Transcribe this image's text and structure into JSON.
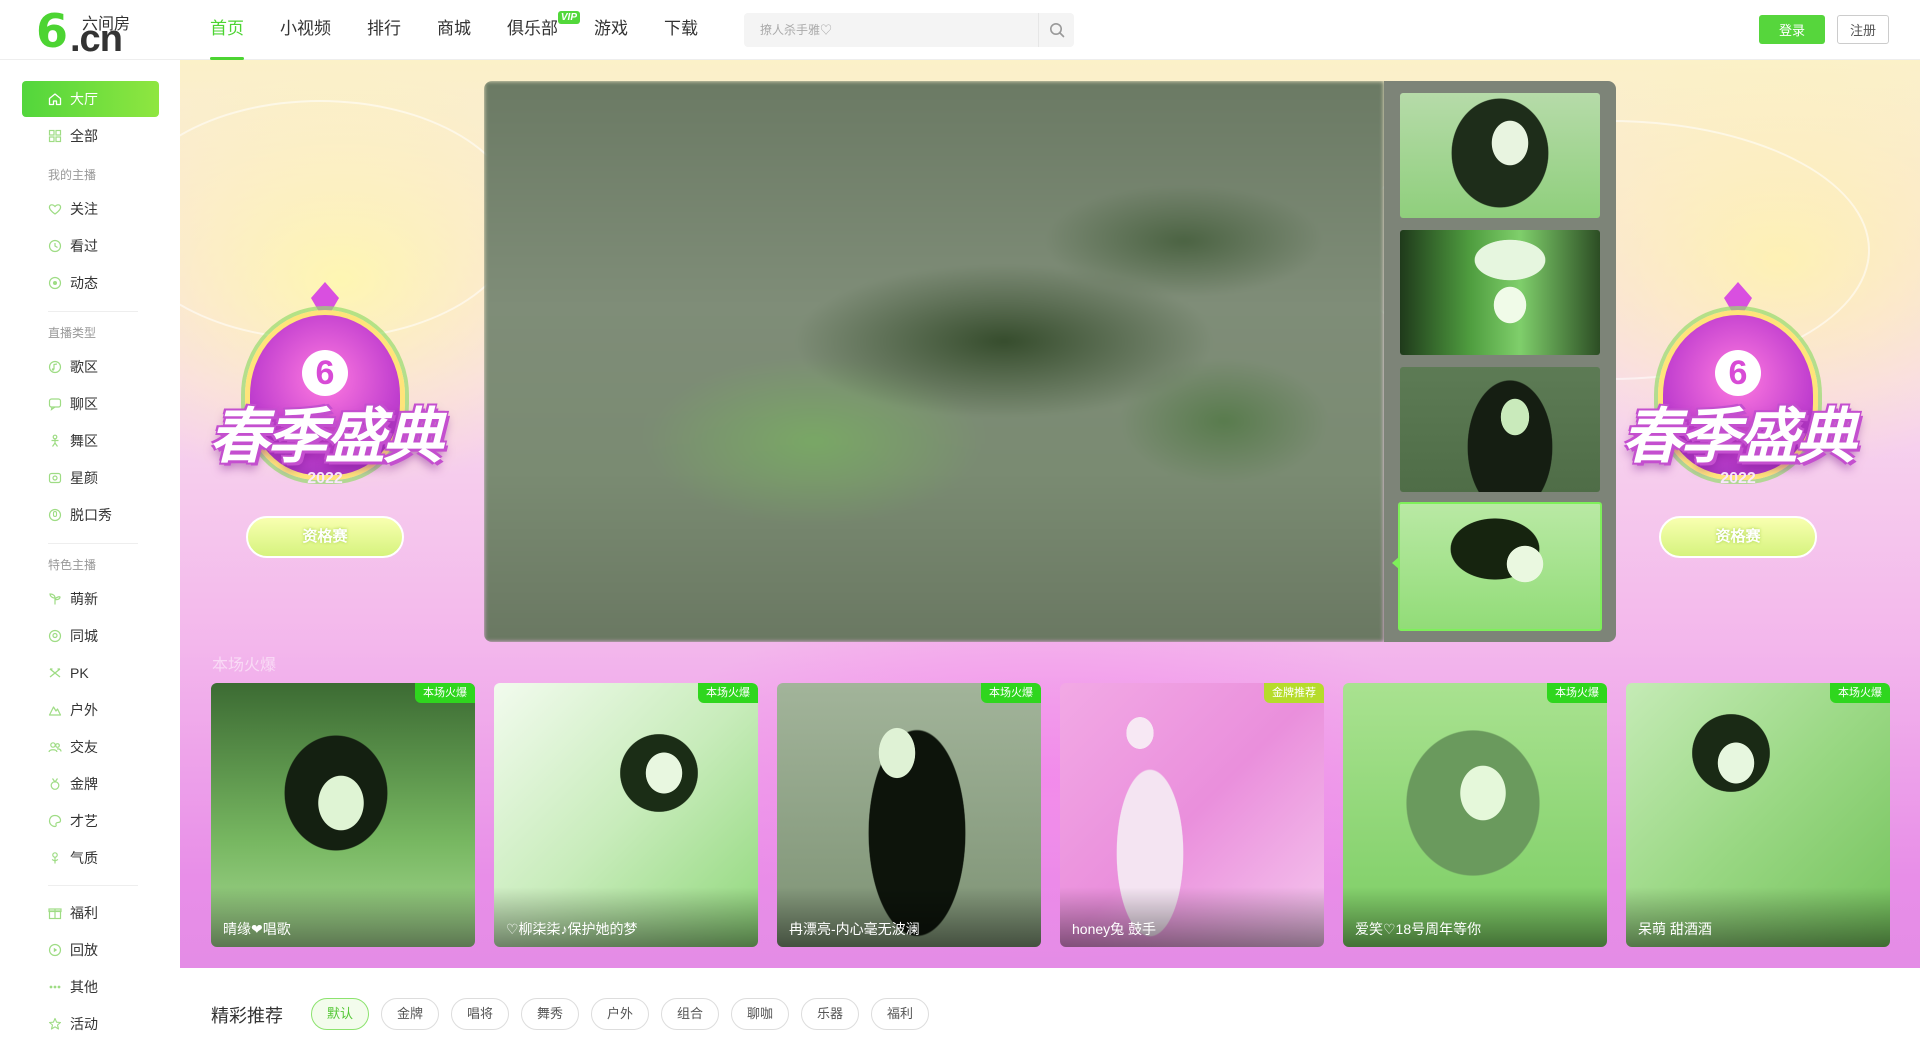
{
  "header": {
    "logo": {
      "six": "6",
      "brand": "六间房",
      "cn": ".cn"
    },
    "nav": [
      {
        "label": "首页",
        "active": true
      },
      {
        "label": "小视频"
      },
      {
        "label": "排行"
      },
      {
        "label": "商城"
      },
      {
        "label": "俱乐部",
        "badge": "VIP"
      },
      {
        "label": "游戏"
      },
      {
        "label": "下载"
      }
    ],
    "search": {
      "placeholder": "撩人杀手雅♡"
    },
    "login_label": "登录",
    "register_label": "注册"
  },
  "sidebar": {
    "top": [
      {
        "label": "大厅",
        "icon": "home-icon",
        "active": true
      },
      {
        "label": "全部",
        "icon": "grid-icon"
      }
    ],
    "my_head": "我的主播",
    "my": [
      {
        "label": "关注",
        "icon": "heart-icon"
      },
      {
        "label": "看过",
        "icon": "clock-icon"
      },
      {
        "label": "动态",
        "icon": "activity-icon"
      }
    ],
    "type_head": "直播类型",
    "types": [
      {
        "label": "歌区",
        "icon": "music-icon"
      },
      {
        "label": "聊区",
        "icon": "chat-icon"
      },
      {
        "label": "舞区",
        "icon": "dance-icon"
      },
      {
        "label": "星颜",
        "icon": "star-face-icon"
      },
      {
        "label": "脱口秀",
        "icon": "mic-icon"
      }
    ],
    "feature_head": "特色主播",
    "features": [
      {
        "label": "萌新",
        "icon": "sprout-icon"
      },
      {
        "label": "同城",
        "icon": "location-icon"
      },
      {
        "label": "PK",
        "icon": "pk-icon"
      },
      {
        "label": "户外",
        "icon": "outdoor-icon"
      },
      {
        "label": "交友",
        "icon": "friends-icon"
      },
      {
        "label": "金牌",
        "icon": "medal-icon"
      },
      {
        "label": "才艺",
        "icon": "palette-icon"
      },
      {
        "label": "气质",
        "icon": "flower-icon"
      }
    ],
    "more": [
      {
        "label": "福利",
        "icon": "gift-icon"
      },
      {
        "label": "回放",
        "icon": "replay-icon"
      },
      {
        "label": "其他",
        "icon": "more-icon"
      },
      {
        "label": "活动",
        "icon": "activity-star-icon"
      }
    ]
  },
  "banner": {
    "event_title": "春季盛典",
    "event_year": "2022",
    "event_pill": "资格赛",
    "section_title": "本场火爆",
    "colors": {
      "accent": "#4cd432",
      "banner_pink": "#e88ee8",
      "banner_yellow": "#fbf1c8"
    },
    "thumbnails": [
      {
        "selected": false
      },
      {
        "selected": false
      },
      {
        "selected": false
      },
      {
        "selected": true
      }
    ],
    "cards": [
      {
        "name": "晴缘❤唱歌",
        "tag": "本场火爆"
      },
      {
        "name": "♡柳柒柒♪保护她的梦",
        "tag": "本场火爆"
      },
      {
        "name": "冉漂亮-内心毫无波澜",
        "tag": "本场火爆"
      },
      {
        "name": "honey兔 鼓手",
        "tag": "金牌推荐"
      },
      {
        "name": "爱笑♡18号周年等你",
        "tag": "本场火爆"
      },
      {
        "name": "呆萌 甜酒酒",
        "tag": "本场火爆"
      }
    ]
  },
  "recommend": {
    "title": "精彩推荐",
    "filters": [
      {
        "label": "默认",
        "active": true
      },
      {
        "label": "金牌"
      },
      {
        "label": "唱将"
      },
      {
        "label": "舞秀"
      },
      {
        "label": "户外"
      },
      {
        "label": "组合"
      },
      {
        "label": "聊咖"
      },
      {
        "label": "乐器"
      },
      {
        "label": "福利"
      }
    ]
  }
}
